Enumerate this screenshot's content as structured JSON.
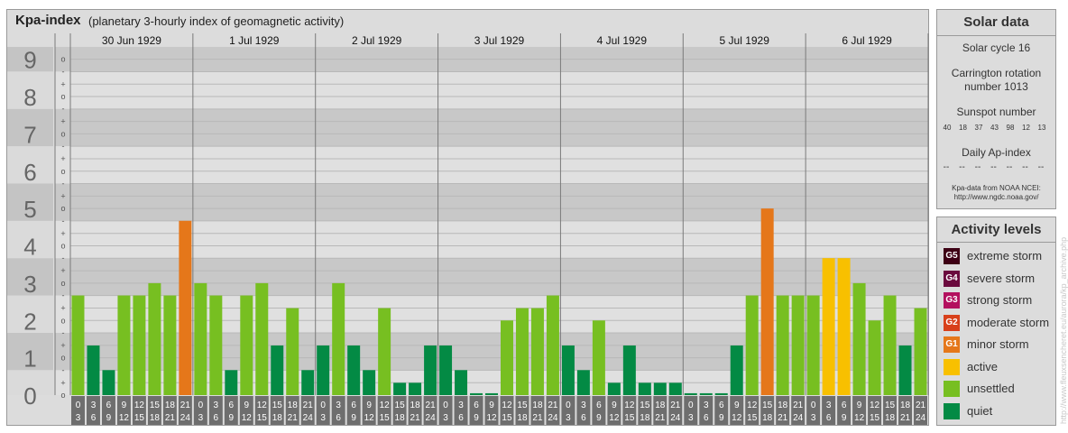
{
  "header": {
    "title": "Kpa-index",
    "subtitle": "(planetary 3-hourly index of geomagnetic activity)"
  },
  "chart_data": {
    "type": "bar",
    "title": "Kpa-index",
    "subtitle": "(planetary 3-hourly index of geomagnetic activity)",
    "ylim": [
      0,
      9.33
    ],
    "y_ticks": [
      "0",
      "1",
      "2",
      "3",
      "4",
      "5",
      "6",
      "7",
      "8",
      "9"
    ],
    "y_minor_ticks": [
      "o",
      "+",
      "-"
    ],
    "days": [
      "30 Jun 1929",
      "1 Jul 1929",
      "2 Jul 1929",
      "3 Jul 1929",
      "4 Jul 1929",
      "5 Jul 1929",
      "6 Jul 1929"
    ],
    "interval_labels": [
      [
        "0",
        "3"
      ],
      [
        "3",
        "6"
      ],
      [
        "6",
        "9"
      ],
      [
        "9",
        "12"
      ],
      [
        "12",
        "15"
      ],
      [
        "15",
        "18"
      ],
      [
        "18",
        "21"
      ],
      [
        "21",
        "24"
      ]
    ],
    "values": [
      [
        2.67,
        1.33,
        0.67,
        2.67,
        2.67,
        3.0,
        2.67,
        4.67
      ],
      [
        3.0,
        2.67,
        0.67,
        2.67,
        3.0,
        1.33,
        2.33,
        0.67
      ],
      [
        1.33,
        3.0,
        1.33,
        0.67,
        2.33,
        0.33,
        0.33,
        1.33
      ],
      [
        1.33,
        0.67,
        0.0,
        0.0,
        2.0,
        2.33,
        2.33,
        2.67
      ],
      [
        1.33,
        0.67,
        2.0,
        0.33,
        1.33,
        0.33,
        0.33,
        0.33
      ],
      [
        0.0,
        0.0,
        0.0,
        1.33,
        2.67,
        5.0,
        2.67,
        2.67
      ],
      [
        2.67,
        3.67,
        3.67,
        3.0,
        2.0,
        2.67,
        1.33,
        2.33
      ]
    ],
    "grid": true
  },
  "solar": {
    "title": "Solar data",
    "cycle": "Solar cycle 16",
    "carrington_line1": "Carrington rotation",
    "carrington_line2": "number 1013",
    "sunspot_label": "Sunspot number",
    "sunspot_values": [
      "40",
      "18",
      "37",
      "43",
      "98",
      "12",
      "13"
    ],
    "ap_label": "Daily Ap-index",
    "ap_values": [
      "--",
      "--",
      "--",
      "--",
      "--",
      "--",
      "--"
    ],
    "source_line1": "Kpa-data from NOAA NCEI:",
    "source_line2": "http://www.ngdc.noaa.gov/"
  },
  "activity": {
    "title": "Activity levels",
    "levels": [
      {
        "badge": "G5",
        "label": "extreme storm",
        "color": "#3d0014"
      },
      {
        "badge": "G4",
        "label": "severe storm",
        "color": "#6b0a3e"
      },
      {
        "badge": "G3",
        "label": "strong storm",
        "color": "#b3105e"
      },
      {
        "badge": "G2",
        "label": "moderate storm",
        "color": "#d8401a"
      },
      {
        "badge": "G1",
        "label": "minor storm",
        "color": "#e5771a"
      },
      {
        "badge": "",
        "label": "active",
        "color": "#f8c000"
      },
      {
        "badge": "",
        "label": "unsettled",
        "color": "#77bf21"
      },
      {
        "badge": "",
        "label": "quiet",
        "color": "#038a44"
      }
    ]
  },
  "colors": {
    "quiet": "#038a44",
    "unsettled": "#77bf21",
    "active": "#f8c000",
    "minor_storm": "#e5771a",
    "moderate_storm": "#d8401a",
    "strong_storm": "#b3105e",
    "severe_storm": "#6b0a3e",
    "extreme_storm": "#3d0014"
  },
  "watermark": "http://www.fleuxsencheret.eu/aurora/kp_archive.php"
}
